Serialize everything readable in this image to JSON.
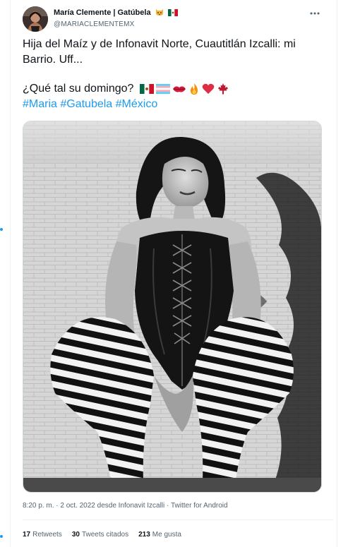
{
  "author": {
    "display_name": "María Clemente | Gatúbela",
    "handle": "@MARIACLEMENTEMX",
    "name_emoji": [
      "cat-face-emoji",
      "mexico-flag-emoji"
    ]
  },
  "more_icon": "ellipsis-icon",
  "tweet": {
    "line1": "Hija del Maíz y de Infonavit Norte, Cuautitlán Izcalli: mi Barrio. Uff...",
    "line2": "¿Qué tal su domingo?",
    "line2_emoji": [
      "mexico-flag-emoji",
      "transgender-flag-emoji",
      "kiss-mark-emoji",
      "fire-emoji",
      "red-heart-emoji",
      "maple-leaf-emoji"
    ],
    "hashtags": [
      "#Maria",
      "#Gatubela",
      "#México"
    ]
  },
  "meta": {
    "time": "8:20 p. m.",
    "date": "2 oct. 2022",
    "location": "desde Infonavit Izcalli",
    "client": "Twitter for Android",
    "separator": "·"
  },
  "stats": [
    {
      "count": "17",
      "label": "Retweets"
    },
    {
      "count": "30",
      "label": "Tweets citados"
    },
    {
      "count": "213",
      "label": "Me gusta"
    }
  ],
  "colors": {
    "accent": "#1d9bf0",
    "text": "#0f1419",
    "secondary": "#536471",
    "border": "#eff3f4"
  }
}
